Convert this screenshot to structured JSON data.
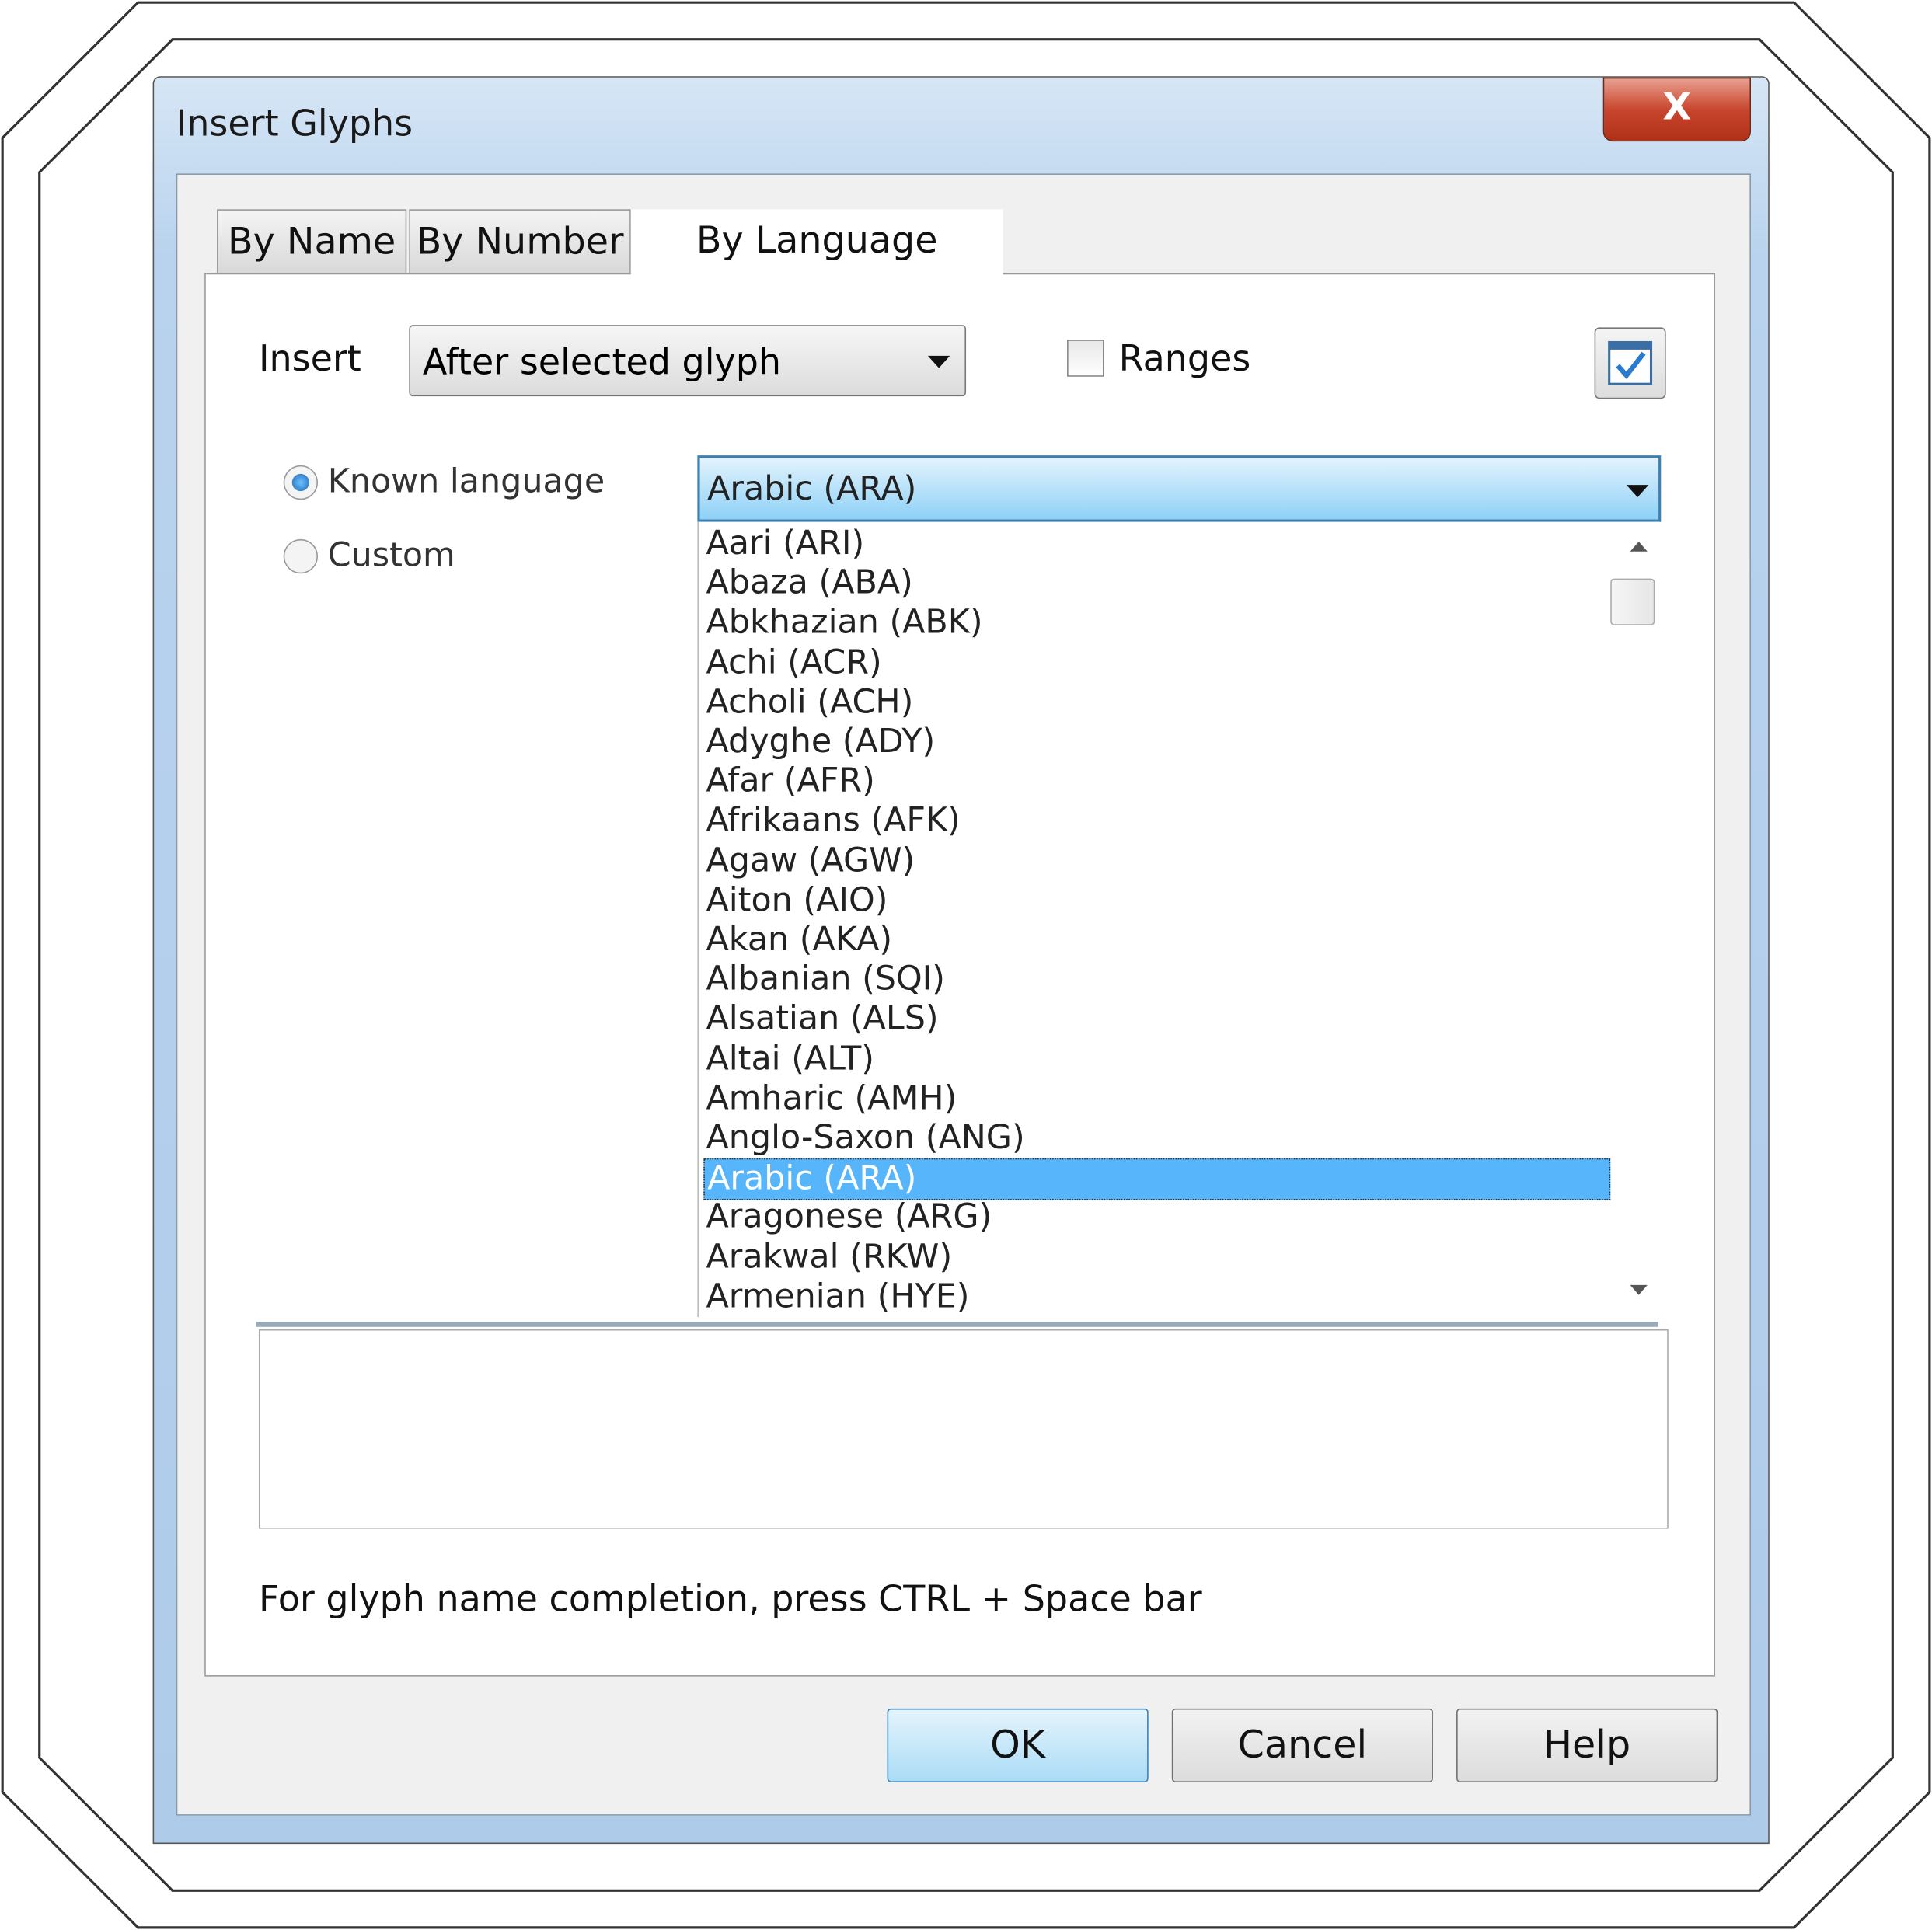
{
  "window": {
    "title": "Insert Glyphs",
    "close_label": "X"
  },
  "tabs": [
    {
      "label": "By Name"
    },
    {
      "label": "By Number"
    },
    {
      "label": "By Language",
      "active": true
    }
  ],
  "insert": {
    "label": "Insert",
    "value": "After selected glyph"
  },
  "ranges": {
    "label": "Ranges",
    "checked": false
  },
  "language": {
    "known_label": "Known language",
    "custom_label": "Custom",
    "selected_mode": "known",
    "combo_value": "Arabic (ARA)",
    "options": [
      "Aari (ARI)",
      "Abaza (ABA)",
      "Abkhazian (ABK)",
      "Achi (ACR)",
      "Acholi (ACH)",
      "Adyghe (ADY)",
      "Afar (AFR)",
      "Afrikaans (AFK)",
      "Agaw (AGW)",
      "Aiton (AIO)",
      "Akan (AKA)",
      "Albanian (SQI)",
      "Alsatian (ALS)",
      "Altai (ALT)",
      "Amharic (AMH)",
      "Anglo-Saxon (ANG)",
      "Arabic (ARA)",
      "Aragonese (ARG)",
      "Arakwal (RKW)",
      "Armenian (HYE)"
    ],
    "selected_index": 16
  },
  "hint": "For glyph name completion, press CTRL + Space bar",
  "buttons": {
    "ok": "OK",
    "cancel": "Cancel",
    "help": "Help"
  },
  "colors": {
    "selection": "#56b5fb",
    "title_bar": "#b9d3ee",
    "close": "#c9462e"
  }
}
